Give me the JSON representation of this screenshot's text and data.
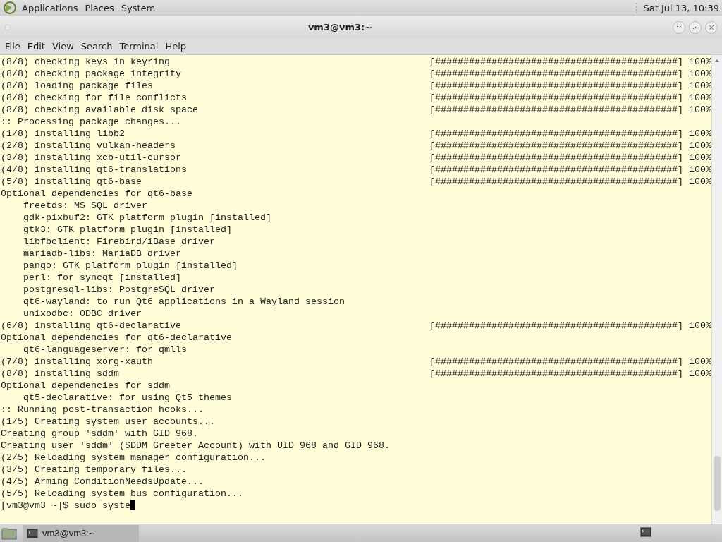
{
  "top_panel": {
    "menus": [
      "Applications",
      "Places",
      "System"
    ],
    "clock": "Sat Jul 13, 10:39"
  },
  "window": {
    "title": "vm3@vm3:~"
  },
  "menu_bar": [
    "File",
    "Edit",
    "View",
    "Search",
    "Terminal",
    "Help"
  ],
  "terminal": {
    "lines": [
      {
        "text": "(8/8) checking keys in keyring",
        "bar": "[###########################################]",
        "percent": "100%"
      },
      {
        "text": "(8/8) checking package integrity",
        "bar": "[###########################################]",
        "percent": "100%"
      },
      {
        "text": "(8/8) loading package files",
        "bar": "[###########################################]",
        "percent": "100%"
      },
      {
        "text": "(8/8) checking for file conflicts",
        "bar": "[###########################################]",
        "percent": "100%"
      },
      {
        "text": "(8/8) checking available disk space",
        "bar": "[###########################################]",
        "percent": "100%"
      },
      {
        "text": ":: Processing package changes..."
      },
      {
        "text": "(1/8) installing libb2",
        "bar": "[###########################################]",
        "percent": "100%"
      },
      {
        "text": "(2/8) installing vulkan-headers",
        "bar": "[###########################################]",
        "percent": "100%"
      },
      {
        "text": "(3/8) installing xcb-util-cursor",
        "bar": "[###########################################]",
        "percent": "100%"
      },
      {
        "text": "(4/8) installing qt6-translations",
        "bar": "[###########################################]",
        "percent": "100%"
      },
      {
        "text": "(5/8) installing qt6-base",
        "bar": "[###########################################]",
        "percent": "100%"
      },
      {
        "text": "Optional dependencies for qt6-base"
      },
      {
        "text": "    freetds: MS SQL driver"
      },
      {
        "text": "    gdk-pixbuf2: GTK platform plugin [installed]"
      },
      {
        "text": "    gtk3: GTK platform plugin [installed]"
      },
      {
        "text": "    libfbclient: Firebird/iBase driver"
      },
      {
        "text": "    mariadb-libs: MariaDB driver"
      },
      {
        "text": "    pango: GTK platform plugin [installed]"
      },
      {
        "text": "    perl: for syncqt [installed]"
      },
      {
        "text": "    postgresql-libs: PostgreSQL driver"
      },
      {
        "text": "    qt6-wayland: to run Qt6 applications in a Wayland session"
      },
      {
        "text": "    unixodbc: ODBC driver"
      },
      {
        "text": "(6/8) installing qt6-declarative",
        "bar": "[###########################################]",
        "percent": "100%"
      },
      {
        "text": "Optional dependencies for qt6-declarative"
      },
      {
        "text": "    qt6-languageserver: for qmlls"
      },
      {
        "text": "(7/8) installing xorg-xauth",
        "bar": "[###########################################]",
        "percent": "100%"
      },
      {
        "text": "(8/8) installing sddm",
        "bar": "[###########################################]",
        "percent": "100%"
      },
      {
        "text": "Optional dependencies for sddm"
      },
      {
        "text": "    qt5-declarative: for using Qt5 themes"
      },
      {
        "text": ":: Running post-transaction hooks..."
      },
      {
        "text": "(1/5) Creating system user accounts..."
      },
      {
        "text": "Creating group 'sddm' with GID 968."
      },
      {
        "text": "Creating user 'sddm' (SDDM Greeter Account) with UID 968 and GID 968."
      },
      {
        "text": "(2/5) Reloading system manager configuration..."
      },
      {
        "text": "(3/5) Creating temporary files..."
      },
      {
        "text": "(4/5) Arming ConditionNeedsUpdate..."
      },
      {
        "text": "(5/5) Reloading system bus configuration..."
      }
    ],
    "prompt": "[vm3@vm3 ~]$ sudo syste"
  },
  "taskbar": {
    "tasks": [
      {
        "label": "vm3@vm3:~",
        "selected": true
      }
    ]
  }
}
